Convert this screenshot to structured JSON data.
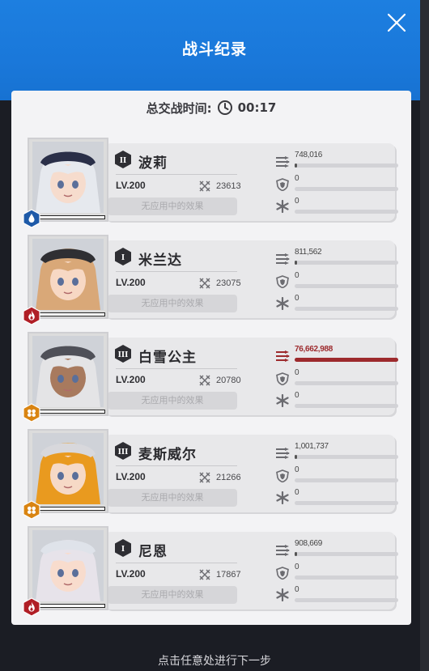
{
  "header": {
    "title": "战斗纪录"
  },
  "battle": {
    "label": "总交战时间:",
    "time": "00:17"
  },
  "colors": {
    "accent_blue": "#1a78da",
    "damage_red": "#9d2a2d",
    "panel": "#f3f3f5"
  },
  "dolls": [
    {
      "name": "波莉",
      "rank_numeral": "II",
      "level": "LV.200",
      "power": "23613",
      "effects": "无应用中的效果",
      "damage": "748,016",
      "damage_fraction": 0.01,
      "damage_highlight": false,
      "defense": "0",
      "defense_fraction": 0,
      "other": "0",
      "other_fraction": 0,
      "type_icon": "water-drop-icon",
      "type_color": "#1e5aa8",
      "hair": "#e6e9ee",
      "cap": "#2a2f48",
      "skin": "#f6dccd"
    },
    {
      "name": "米兰达",
      "rank_numeral": "I",
      "level": "LV.200",
      "power": "23075",
      "effects": "无应用中的效果",
      "damage": "811,562",
      "damage_fraction": 0.01,
      "damage_highlight": false,
      "defense": "0",
      "defense_fraction": 0,
      "other": "0",
      "other_fraction": 0,
      "type_icon": "flame-icon",
      "type_color": "#b01e26",
      "hair": "#d9a878",
      "cap": "#2f2f33",
      "skin": "#f7d8c4"
    },
    {
      "name": "白雪公主",
      "rank_numeral": "III",
      "level": "LV.200",
      "power": "20780",
      "effects": "无应用中的效果",
      "damage": "76,662,988",
      "damage_fraction": 1.0,
      "damage_highlight": true,
      "defense": "0",
      "defense_fraction": 0,
      "other": "0",
      "other_fraction": 0,
      "type_icon": "hex-cluster-icon",
      "type_color": "#d98412",
      "hair": "#e4e4e6",
      "cap": "#4f5058",
      "skin": "#a87a5e"
    },
    {
      "name": "麦斯威尔",
      "rank_numeral": "III",
      "level": "LV.200",
      "power": "21266",
      "effects": "无应用中的效果",
      "damage": "1,001,737",
      "damage_fraction": 0.013,
      "damage_highlight": false,
      "defense": "0",
      "defense_fraction": 0,
      "other": "0",
      "other_fraction": 0,
      "type_icon": "hex-cluster-icon",
      "type_color": "#d98412",
      "hair": "#e99a1f",
      "cap": "#d8d8dc",
      "skin": "#f6d9c6"
    },
    {
      "name": "尼恩",
      "rank_numeral": "I",
      "level": "LV.200",
      "power": "17867",
      "effects": "无应用中的效果",
      "damage": "908,669",
      "damage_fraction": 0.012,
      "damage_highlight": false,
      "defense": "0",
      "defense_fraction": 0,
      "other": "0",
      "other_fraction": 0,
      "type_icon": "flame-icon",
      "type_color": "#b01e26",
      "hair": "#e7e3ea",
      "cap": "#dfe3ea",
      "skin": "#f8dccd"
    }
  ],
  "footer": {
    "hint": "点击任意处进行下一步"
  }
}
